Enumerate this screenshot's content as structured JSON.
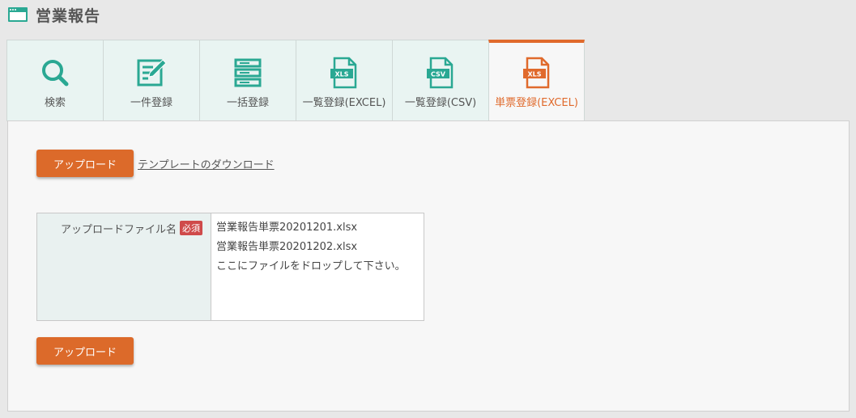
{
  "header": {
    "title": "営業報告"
  },
  "tabs": [
    {
      "label": "検索",
      "icon": "search-icon",
      "active": false
    },
    {
      "label": "一件登録",
      "icon": "edit-form-icon",
      "active": false
    },
    {
      "label": "一括登録",
      "icon": "list-stack-icon",
      "active": false
    },
    {
      "label": "一覧登録(EXCEL)",
      "icon": "xls-file-icon",
      "active": false
    },
    {
      "label": "一覧登録(CSV)",
      "icon": "csv-file-icon",
      "active": false
    },
    {
      "label": "単票登録(EXCEL)",
      "icon": "xls-file-icon",
      "active": true
    }
  ],
  "icon_labels": {
    "xls": "XLS",
    "csv": "CSV"
  },
  "actions": {
    "upload_label": "アップロード",
    "template_link": "テンプレートのダウンロード"
  },
  "form": {
    "file_label": "アップロードファイル名",
    "required_badge": "必須",
    "files": [
      "営業報告単票20201201.xlsx",
      "営業報告単票20201202.xlsx"
    ],
    "drop_hint": "ここにファイルをドロップして下さい。"
  },
  "colors": {
    "accent": "#dc6a2a",
    "teal": "#2aa893",
    "tab_bg": "#e9f4f2",
    "required": "#cf4a4a"
  }
}
